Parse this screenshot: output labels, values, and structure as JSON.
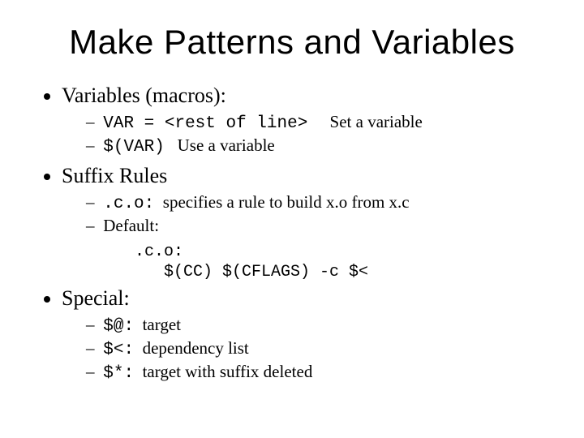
{
  "title": "Make Patterns and Variables",
  "sections": [
    {
      "heading": "Variables (macros):",
      "items": [
        {
          "code": "VAR = <rest of line>",
          "note": "Set a variable",
          "gap": true
        },
        {
          "code": "$(VAR)",
          "note": "Use a variable"
        }
      ]
    },
    {
      "heading": "Suffix Rules",
      "items": [
        {
          "code": ".c.o:",
          "note": "specifies a rule to build x.o from x.c"
        },
        {
          "plain": "Default:"
        }
      ],
      "codeblock": [
        ".c.o:",
        "   $(CC) $(CFLAGS) -c $<"
      ]
    },
    {
      "heading": "Special:",
      "items": [
        {
          "code": "$@:",
          "note": "target"
        },
        {
          "code": "$<:",
          "note": "dependency list"
        },
        {
          "code": "$*:",
          "note": "target with suffix deleted"
        }
      ]
    }
  ]
}
